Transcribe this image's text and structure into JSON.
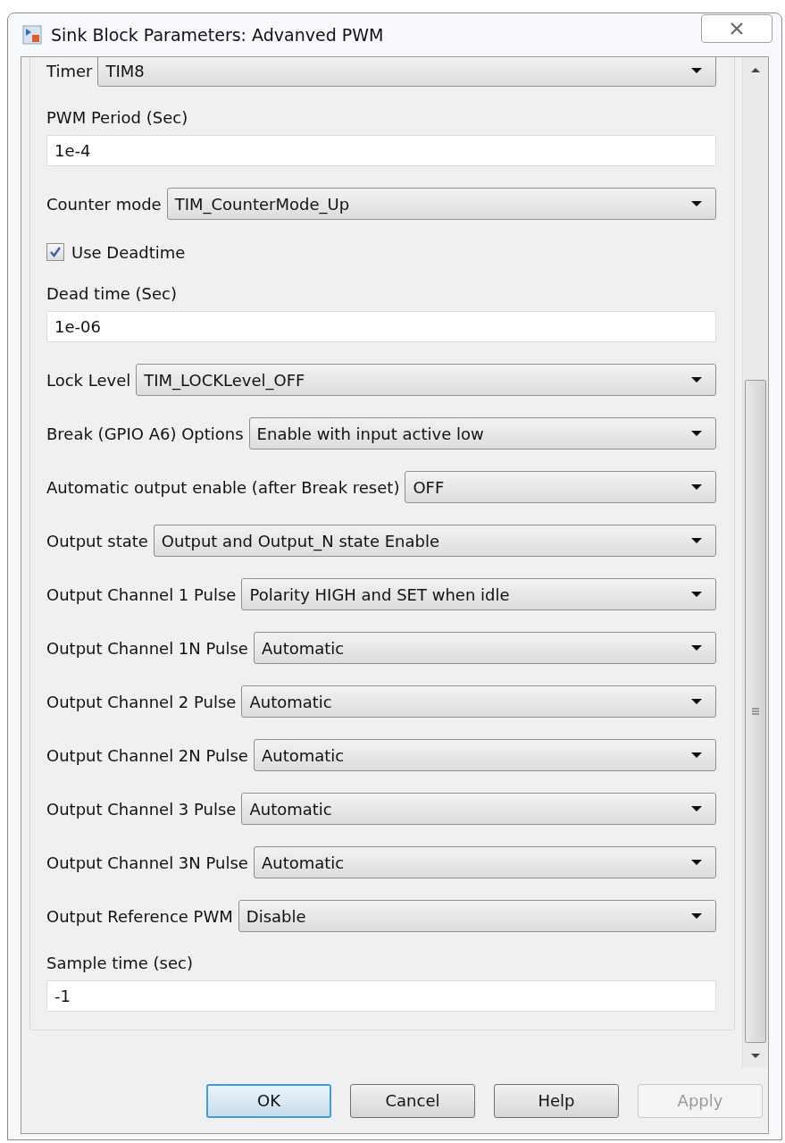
{
  "window": {
    "title": "Sink Block Parameters: Advanved PWM"
  },
  "fields": [
    {
      "kind": "select",
      "label": "Timer",
      "value": "TIM8"
    },
    {
      "kind": "text",
      "label": "PWM Period (Sec)",
      "value": "1e-4"
    },
    {
      "kind": "select",
      "label": "Counter mode",
      "value": "TIM_CounterMode_Up"
    },
    {
      "kind": "checkbox",
      "label": "Use Deadtime",
      "checked": true
    },
    {
      "kind": "text",
      "label": "Dead time (Sec)",
      "value": "1e-06"
    },
    {
      "kind": "select",
      "label": "Lock Level",
      "value": "TIM_LOCKLevel_OFF"
    },
    {
      "kind": "select",
      "label": "Break (GPIO A6) Options",
      "value": "Enable with input active low"
    },
    {
      "kind": "select",
      "label": "Automatic output enable (after Break reset)",
      "value": "OFF"
    },
    {
      "kind": "select",
      "label": "Output state",
      "value": "Output and Output_N state Enable"
    },
    {
      "kind": "select",
      "label": "Output Channel 1 Pulse",
      "value": "Polarity HIGH and SET when idle"
    },
    {
      "kind": "select",
      "label": "Output Channel 1N Pulse",
      "value": "Automatic"
    },
    {
      "kind": "select",
      "label": "Output Channel 2 Pulse",
      "value": "Automatic"
    },
    {
      "kind": "select",
      "label": "Output Channel 2N Pulse",
      "value": "Automatic"
    },
    {
      "kind": "select",
      "label": "Output Channel 3 Pulse",
      "value": "Automatic"
    },
    {
      "kind": "select",
      "label": "Output Channel 3N Pulse",
      "value": "Automatic"
    },
    {
      "kind": "select",
      "label": "Output Reference PWM",
      "value": "Disable"
    },
    {
      "kind": "text",
      "label": "Sample time (sec)",
      "value": "-1"
    }
  ],
  "buttons": [
    {
      "label": "OK",
      "default": true,
      "disabled": false
    },
    {
      "label": "Cancel",
      "default": false,
      "disabled": false
    },
    {
      "label": "Help",
      "default": false,
      "disabled": false
    },
    {
      "label": "Apply",
      "default": false,
      "disabled": true
    }
  ]
}
